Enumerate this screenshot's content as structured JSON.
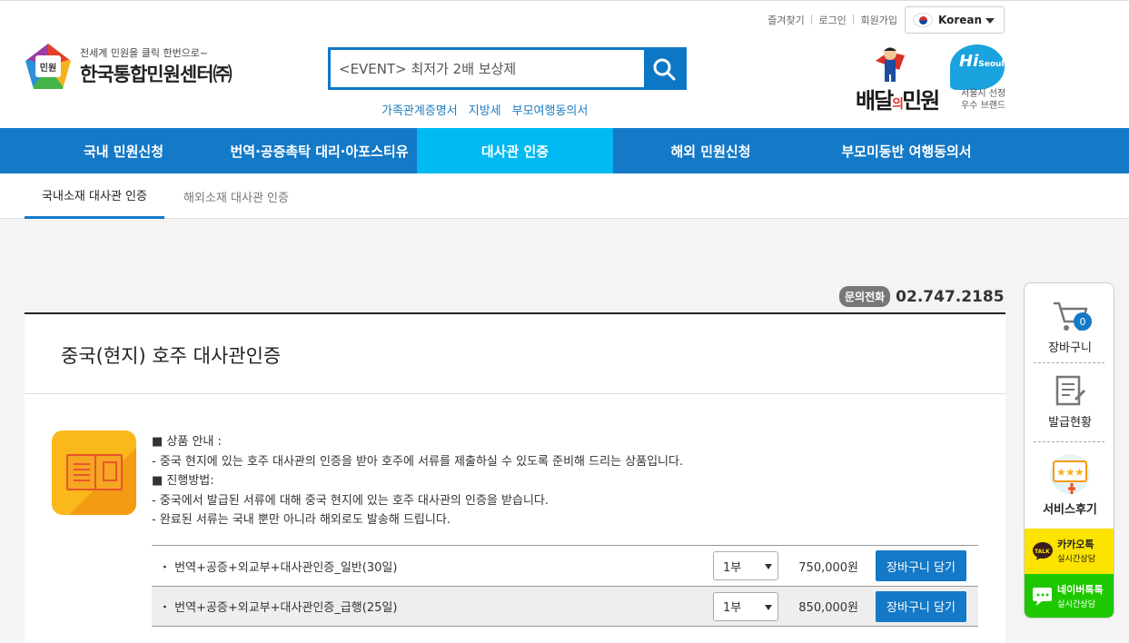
{
  "header": {
    "util_links": [
      "즐겨찾기",
      "로그인",
      "회원가입"
    ],
    "language": "Korean",
    "logo_sub": "전세계 민원을 클릭 한번으로~",
    "logo_main": "한국통합민원센터㈜",
    "logo_badge": "민원",
    "search_value": "<EVENT> 최저가 2배 보상제",
    "keywords": [
      "가족관계증명서",
      "지방세",
      "부모여행동의서"
    ],
    "promo_brand_1": "배달",
    "promo_brand_o": "의",
    "promo_brand_2": "민원",
    "promo_hi": "Hi",
    "promo_seoul": "Seoul",
    "promo_tag_1": "서울시 선정",
    "promo_tag_2": "우수 브랜드"
  },
  "nav": {
    "items": [
      "국내 민원신청",
      "번역·공증촉탁 대리·아포스티유",
      "대사관 인증",
      "해외 민원신청",
      "부모미동반 여행동의서"
    ],
    "active_index": 2
  },
  "subnav": {
    "items": [
      "국내소재 대사관 인증",
      "해외소재 대사관 인증"
    ],
    "active_index": 0
  },
  "contact": {
    "badge": "문의전화",
    "phone": "02.747.2185"
  },
  "product": {
    "title": "중국(현지) 호주 대사관인증",
    "desc": [
      "■ 상품 안내 :",
      "- 중국 현지에 있는 호주 대사관의 인증을 받아 호주에 서류를 제출하실 수 있도록 준비해 드리는 상품입니다.",
      "■ 진행방법:",
      "- 중국에서 발급된 서류에 대해 중국 현지에 있는 호주 대사관의 인증을 받습니다.",
      "- 완료된 서류는 국내 뿐만 아니라 해외로도 발송해 드립니다."
    ],
    "options": [
      {
        "name": "번역+공증+외교부+대사관인증_일반(30일)",
        "qty": "1부",
        "price": "750,000원",
        "button": "장바구니 담기"
      },
      {
        "name": "번역+공증+외교부+대사관인증_급행(25일)",
        "qty": "1부",
        "price": "850,000원",
        "button": "장바구니 담기"
      }
    ]
  },
  "quick": {
    "cart_label": "장바구니",
    "cart_count": "0",
    "issue_label": "발급현황",
    "review_label": "서비스후기",
    "kakao_title": "카카오톡",
    "kakao_sub": "실시간상담",
    "kakao_icon": "TALK",
    "naver_title": "네이버톡톡",
    "naver_sub": "실시간상담"
  },
  "colors": {
    "nav_bg": "#1479c7",
    "nav_active": "#00b9f1",
    "accent": "#0c78c5",
    "kakao": "#fce300",
    "naver": "#1ec800"
  }
}
